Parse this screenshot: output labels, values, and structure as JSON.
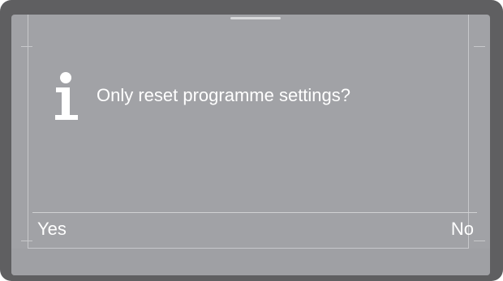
{
  "dialog": {
    "icon": "info-icon",
    "message": "Only reset programme settings?",
    "buttons": {
      "yes": "Yes",
      "no": "No"
    }
  },
  "colors": {
    "frame": "#5f5f61",
    "screen": "#a1a2a6",
    "text": "#ffffff",
    "lines": "#c7c8cb"
  }
}
